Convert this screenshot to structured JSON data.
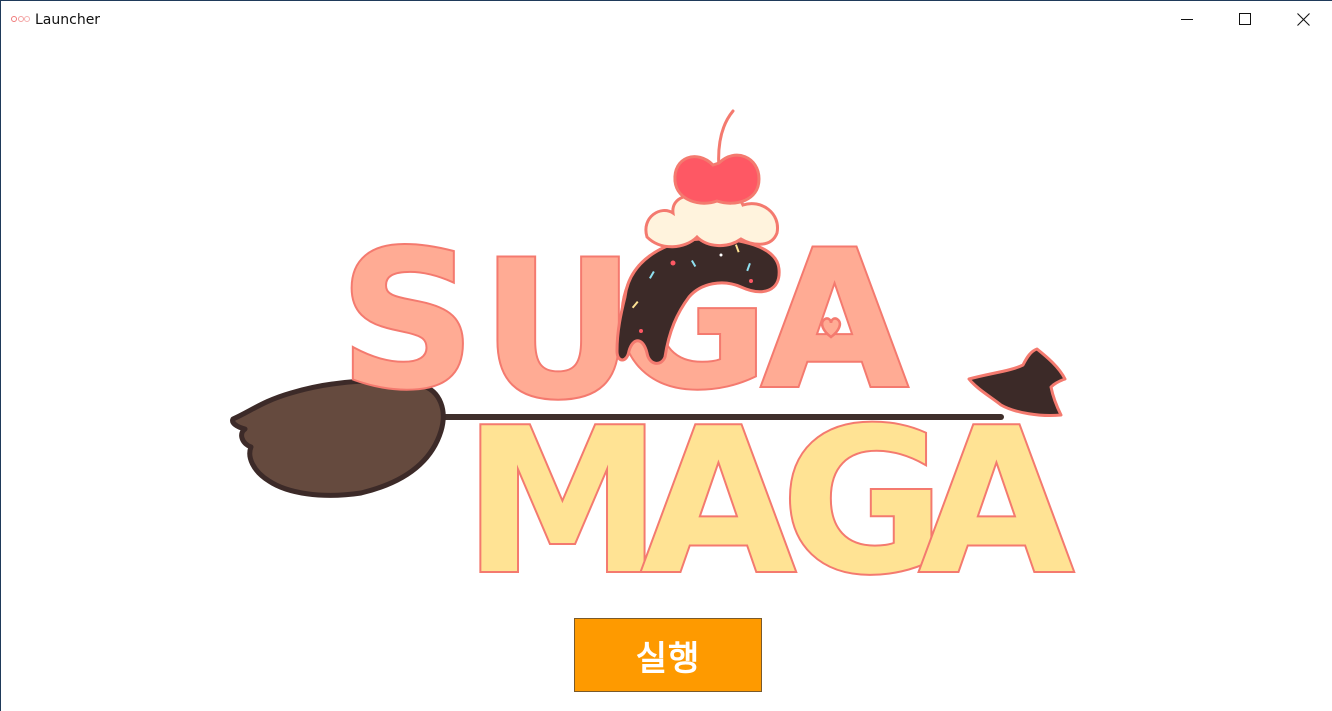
{
  "window": {
    "title": "Launcher",
    "controls": {
      "minimize": "minimize-icon",
      "maximize": "maximize-icon",
      "close": "close-icon"
    }
  },
  "logo": {
    "line1": [
      "S",
      "U",
      "G",
      "A"
    ],
    "line2": [
      "M",
      "A",
      "G",
      "A"
    ],
    "colors": {
      "line1_fill": "#ffab94",
      "line2_fill": "#ffe394",
      "outline": "#f47a6f",
      "broom": "#654a3e",
      "chocolate": "#3c2a28",
      "cherry": "#fe5864",
      "cream": "#fff3dd"
    }
  },
  "run_button": {
    "label": "실행",
    "color": "#fe9a00"
  }
}
